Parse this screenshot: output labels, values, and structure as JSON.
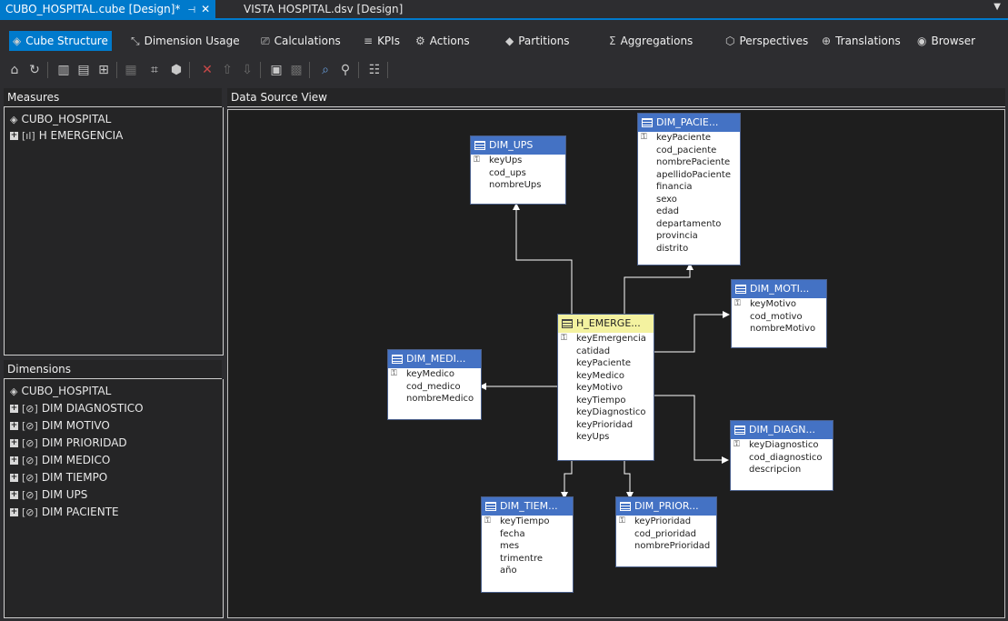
{
  "doc_tabs": {
    "active": "CUBO_HOSPITAL.cube [Design]*",
    "pin": "⊣",
    "close": "✕",
    "inactive": "VISTA HOSPITAL.dsv [Design]",
    "dropdown": "▼"
  },
  "designer_tabs": [
    {
      "label": "Cube Structure",
      "icon": "cube-icon"
    },
    {
      "label": "Dimension Usage",
      "icon": "dimension-usage-icon"
    },
    {
      "label": "Calculations",
      "icon": "calculator-icon"
    },
    {
      "label": "KPIs",
      "icon": "kpi-icon"
    },
    {
      "label": "Actions",
      "icon": "actions-icon"
    },
    {
      "label": "Partitions",
      "icon": "partitions-icon"
    },
    {
      "label": "Aggregations",
      "icon": "aggregations-icon"
    },
    {
      "label": "Perspectives",
      "icon": "perspectives-icon"
    },
    {
      "label": "Translations",
      "icon": "translations-icon"
    },
    {
      "label": "Browser",
      "icon": "browser-icon"
    }
  ],
  "measures_panel": {
    "title": "Measures",
    "root": "CUBO_HOSPITAL",
    "items": [
      "H EMERGENCIA"
    ],
    "expander": "+"
  },
  "dimensions_panel": {
    "title": "Dimensions",
    "root": "CUBO_HOSPITAL",
    "items": [
      "DIM DIAGNOSTICO",
      "DIM MOTIVO",
      "DIM PRIORIDAD",
      "DIM MEDICO",
      "DIM TIEMPO",
      "DIM UPS",
      "DIM PACIENTE"
    ],
    "expander": "+"
  },
  "dsv": {
    "title": "Data Source View",
    "key_icon": "⚿",
    "tables": {
      "ups": {
        "name": "DIM_UPS",
        "columns": [
          "keyUps",
          "cod_ups",
          "nombreUps"
        ]
      },
      "paciente": {
        "name": "DIM_PACIE...",
        "columns": [
          "keyPaciente",
          "cod_paciente",
          "nombrePaciente",
          "apellidoPaciente",
          "financia",
          "sexo",
          "edad",
          "departamento",
          "provincia",
          "distrito"
        ]
      },
      "motivo": {
        "name": "DIM_MOTI...",
        "columns": [
          "keyMotivo",
          "cod_motivo",
          "nombreMotivo"
        ]
      },
      "fact": {
        "name": "H_EMERGE...",
        "columns": [
          "keyEmergencia",
          "catidad",
          "keyPaciente",
          "keyMedico",
          "keyMotivo",
          "keyTiempo",
          "keyDiagnostico",
          "keyPrioridad",
          "keyUps"
        ]
      },
      "medico": {
        "name": "DIM_MEDI...",
        "columns": [
          "keyMedico",
          "cod_medico",
          "nombreMedico"
        ]
      },
      "diagnostico": {
        "name": "DIM_DIAGN...",
        "columns": [
          "keyDiagnostico",
          "cod_diagnostico",
          "descripcion"
        ]
      },
      "tiempo": {
        "name": "DIM_TIEM...",
        "columns": [
          "keyTiempo",
          "fecha",
          "mes",
          "trimentre",
          "año"
        ]
      },
      "prioridad": {
        "name": "DIM_PRIOR...",
        "columns": [
          "keyPrioridad",
          "cod_prioridad",
          "nombrePrioridad"
        ]
      }
    }
  },
  "colors": {
    "accent": "#007acc",
    "table_header": "#4472c4",
    "fact_header": "#f4f2a0",
    "canvas": "#1e1e1e"
  }
}
